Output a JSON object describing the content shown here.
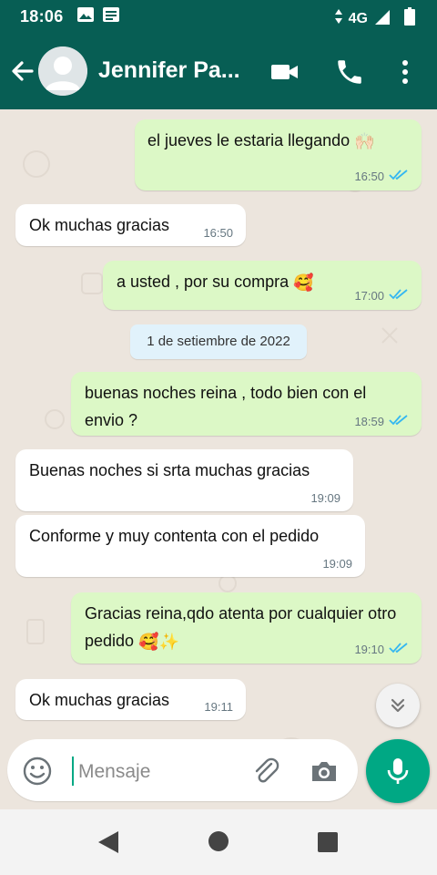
{
  "status_bar": {
    "time": "18:06",
    "network": "4G"
  },
  "header": {
    "contact_name": "Jennifer Pa..."
  },
  "messages": [
    {
      "dir": "out",
      "text": "el jueves le estaria llegando",
      "emoji": "🙌🏻",
      "time": "16:50"
    },
    {
      "dir": "in",
      "text": "Ok muchas gracias",
      "time": "16:50"
    },
    {
      "dir": "out",
      "text": "a usted , por su compra",
      "emoji": "🥰",
      "time": "17:00"
    },
    {
      "dir": "out",
      "text": "buenas noches reina , todo bien con el envio ?",
      "time": "18:59"
    },
    {
      "dir": "in",
      "text": "Buenas noches si srta muchas gracias",
      "time": "19:09"
    },
    {
      "dir": "in",
      "text": "Conforme y muy contenta con el pedido",
      "time": "19:09"
    },
    {
      "dir": "out",
      "text": "Gracias reina,qdo atenta por cualquier otro pedido",
      "emoji": "🥰✨",
      "time": "19:10"
    },
    {
      "dir": "in",
      "text": "Ok muchas gracias",
      "time": "19:11"
    }
  ],
  "date_separator": "1 de setiembre de 2022",
  "composer": {
    "placeholder": "Mensaje"
  },
  "colors": {
    "header": "#075e54",
    "outgoing_bubble": "#dcf8c6",
    "incoming_bubble": "#ffffff",
    "accent": "#00a884",
    "read_ticks": "#34b7f1"
  }
}
